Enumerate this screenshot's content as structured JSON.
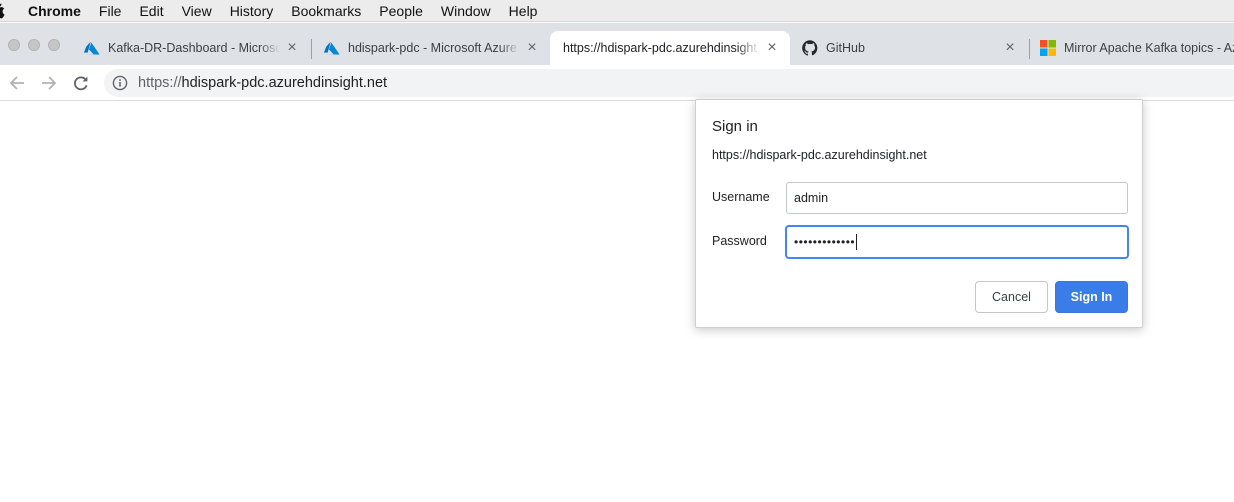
{
  "menubar": {
    "app": "Chrome",
    "items": [
      "File",
      "Edit",
      "View",
      "History",
      "Bookmarks",
      "People",
      "Window",
      "Help"
    ]
  },
  "tabs": [
    {
      "title": "Kafka-DR-Dashboard - Microsoft Azure",
      "favicon": "azure-icon",
      "active": false
    },
    {
      "title": "hdispark-pdc - Microsoft Azure",
      "favicon": "azure-icon",
      "active": false
    },
    {
      "title": "https://hdispark-pdc.azurehdinsight.net",
      "favicon": "none",
      "active": true
    },
    {
      "title": "GitHub",
      "favicon": "github-icon",
      "active": false
    },
    {
      "title": "Mirror Apache Kafka topics - Azure",
      "favicon": "microsoft-icon",
      "active": false
    }
  ],
  "toolbar": {
    "url_scheme": "https://",
    "url_host": "hdispark-pdc.azurehdinsight.net"
  },
  "dialog": {
    "title": "Sign in",
    "origin": "https://hdispark-pdc.azurehdinsight.net",
    "username_label": "Username",
    "username_value": "admin",
    "password_label": "Password",
    "password_mask": "•••••••••••••",
    "cancel_label": "Cancel",
    "signin_label": "Sign In"
  },
  "colors": {
    "accent": "#3b7de8",
    "focus": "#4285f4",
    "tabstrip": "#dee1e6"
  }
}
